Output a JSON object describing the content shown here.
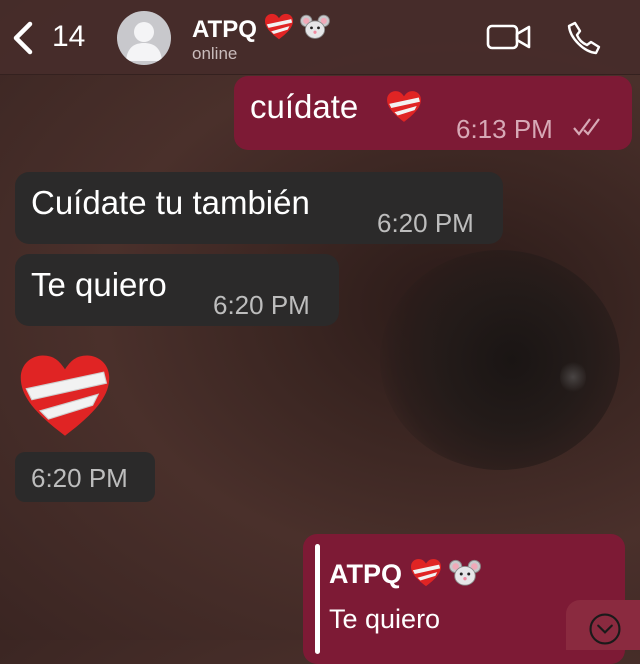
{
  "header": {
    "back_count": "14",
    "contact_name": "ATPQ",
    "status": "online"
  },
  "messages": [
    {
      "text": "cuídate",
      "time": "6:13 PM"
    },
    {
      "text": "Cuídate tu también",
      "time": "6:20 PM"
    },
    {
      "text": "Te quiero",
      "time": "6:20 PM"
    },
    {
      "time": "6:20 PM"
    }
  ],
  "reply_preview": {
    "name": "ATPQ",
    "text": "Te quiero"
  },
  "colors": {
    "outgoing_bubble": "#7d1a35",
    "incoming_bubble": "#2b2a2a"
  },
  "icons": [
    "chevron-left-icon",
    "avatar-placeholder-icon",
    "mended-heart-emoji",
    "mouse-face-emoji",
    "video-call-icon",
    "phone-icon",
    "double-check-icon",
    "chevron-down-icon"
  ]
}
